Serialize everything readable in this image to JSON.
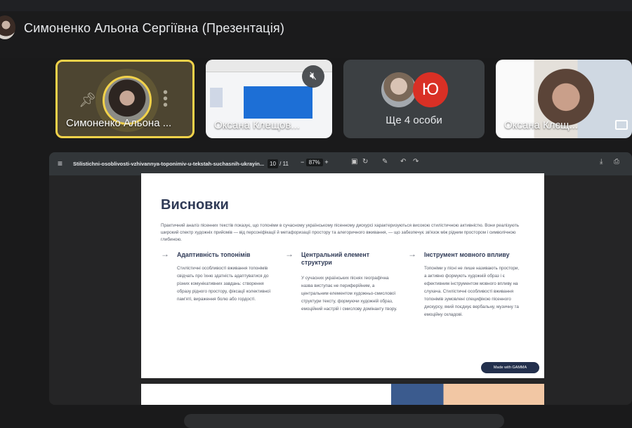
{
  "header": {
    "title": "Симоненко Альона Сергіївна (Презентація)"
  },
  "tiles": [
    {
      "name": "Симоненко Альона ..."
    },
    {
      "name": "Оксана Клещов..."
    },
    {
      "avatar_letter": "Ю",
      "count_label": "Ще 4 особи"
    },
    {
      "name": "Оксана Клєщ..."
    }
  ],
  "viewer": {
    "file_name": "Stilistichni-osoblivosti-vzhivannya-toponimiv-u-tekstah-suchasnih-ukrayin...",
    "page_current": "10",
    "page_total": "/ 11",
    "zoom": "87%",
    "slide": {
      "heading": "Висновки",
      "intro": "Практичний аналіз пісенних текстів показує, що топоніми в сучасному українському пісенному дискурсі характеризуються високою стилістичною активністю. Вони реалізують широкий спектр художніх прийомів — від персоніфікації й метафоризації простору та алегоричного вживання, — що забезпечує зв'язок між рідним простором і символічною глибиною.",
      "columns": [
        {
          "title": "Адаптивність топонімів",
          "body": "Стилістичні особливості вживання топонімів свідчать про їхню здатність адаптуватися до різних комунікативних завдань: створення образу рідного простору, фіксації колективної пам'яті, вираження болю або гордості."
        },
        {
          "title": "Центральний елемент структури",
          "body": "У сучасних українських піснях географічна назва виступає не периферійним, а центральним елементом художньо-смислової структури тексту, формуючи художній образ, емоційний настрій і смислову домінанту твору."
        },
        {
          "title": "Інструмент мовного впливу",
          "body": "Топоніми у пісні не лише називають простори, а активно формують художній образ і є ефективним інструментом мовного впливу на слухача. Стилістичні особливості вживання топонімів зумовлені специфікою пісенного дискурсу, який поєднує вербальну, музичну та емоційну складові."
        }
      ],
      "badge": "Made with GAMMA"
    }
  }
}
